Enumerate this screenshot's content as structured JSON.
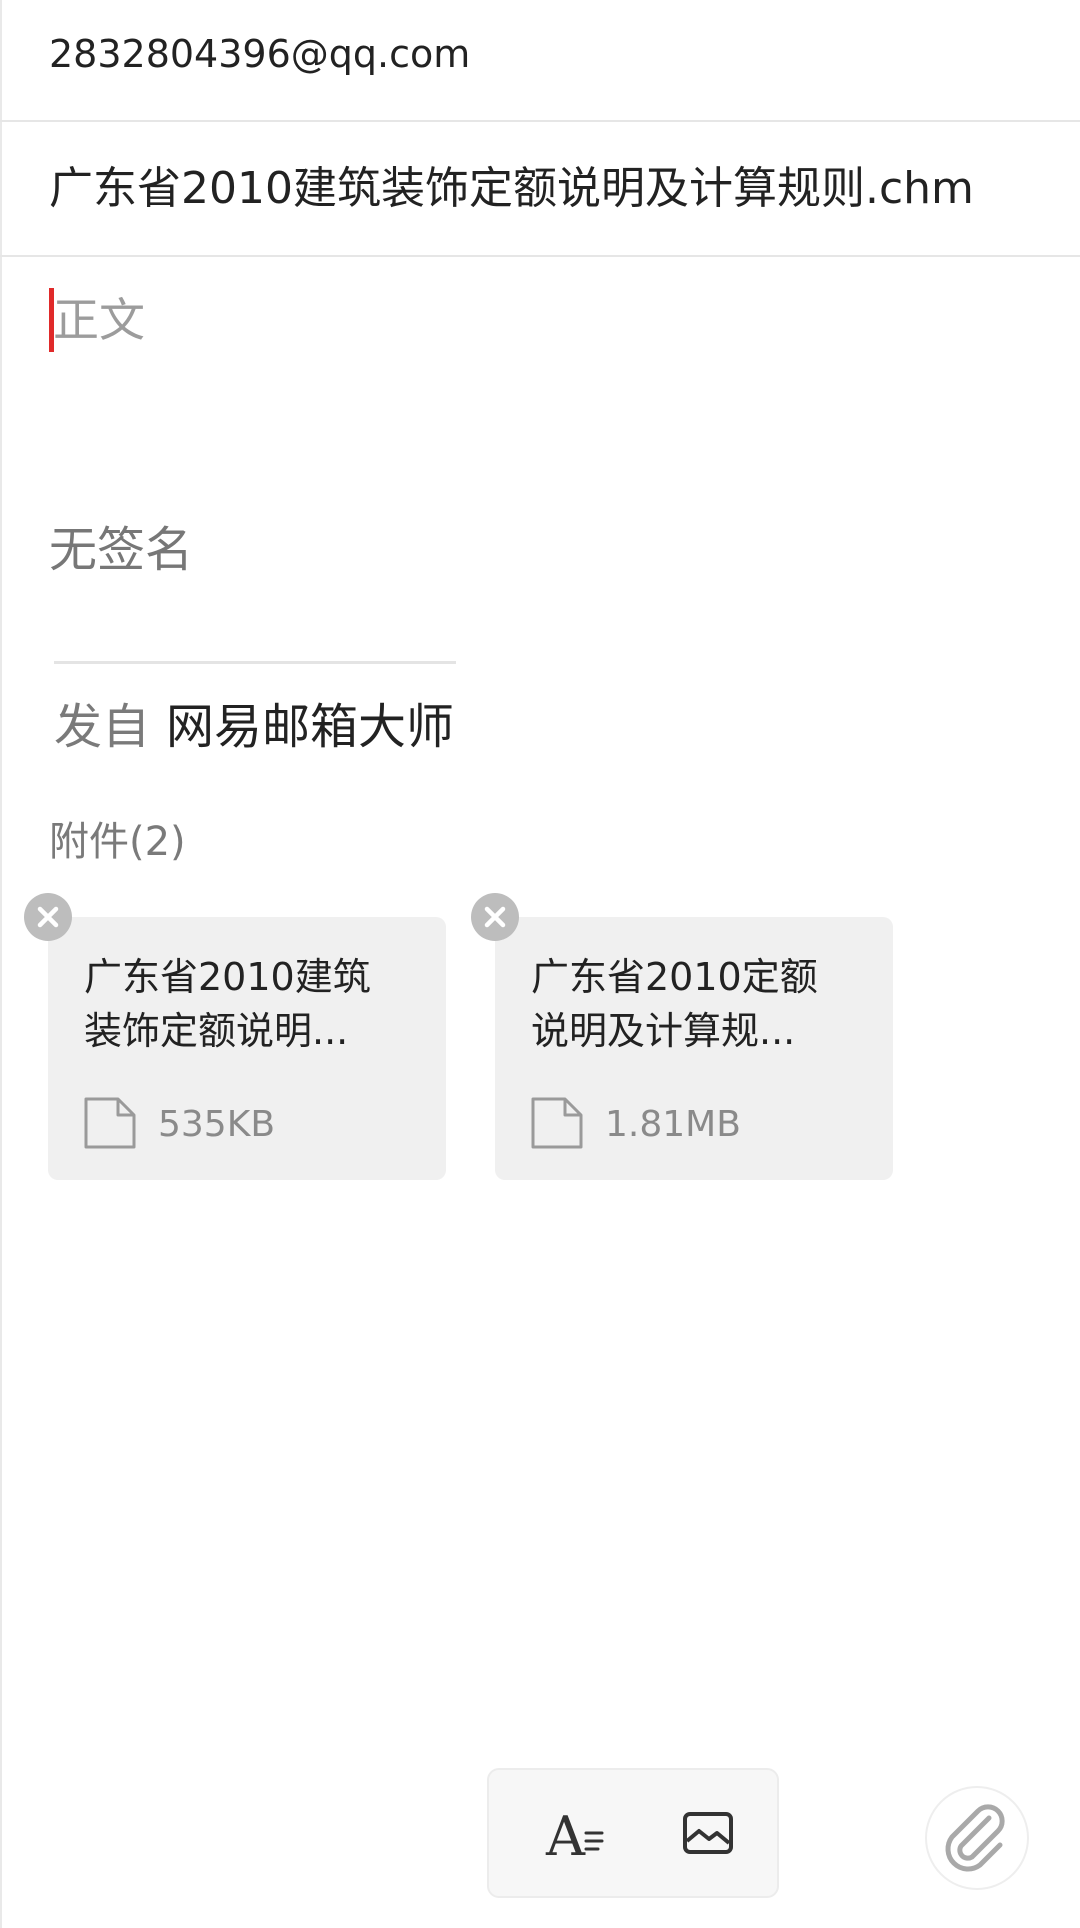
{
  "compose": {
    "sender": "2832804396@qq.com",
    "subject": "广东省2010建筑装饰定额说明及计算规则.chm",
    "body_placeholder": "正文",
    "signature": "无签名",
    "sent_from_prefix": "发自",
    "sent_from_app": "网易邮箱大师"
  },
  "attachments": {
    "header": "附件(2)",
    "items": [
      {
        "name": "广东省2010建筑装饰定额说明...",
        "size": "535KB",
        "icon": "file-icon"
      },
      {
        "name": "广东省2010定额说明及计算规...",
        "size": "1.81MB",
        "icon": "file-icon"
      }
    ]
  },
  "toolbar": {
    "text_format_icon": "text-format-icon",
    "insert_image_icon": "image-icon",
    "attach_icon": "paperclip-icon"
  },
  "colors": {
    "cursor": "#e02a2a",
    "attachment_bg": "#f0f0f0",
    "remove_badge": "#bdbdbd"
  }
}
